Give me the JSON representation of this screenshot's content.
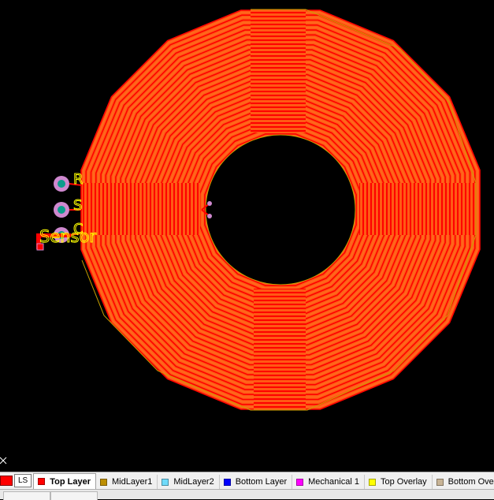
{
  "colors": {
    "board_bg": "#000000",
    "copper_top": "#ff0000",
    "copper_base": "#ff5a14",
    "silkscreen": "#ffff00",
    "outline": "#c8a000",
    "pad_ring": "#cf88cf",
    "pad_center": "#0c9c8c"
  },
  "silkscreen": {
    "label_r": "R",
    "label_s": "S",
    "label_c": "C",
    "designator": "Sensor"
  },
  "layer_bar": {
    "ls_label": "LS",
    "tabs": [
      {
        "name": "top-layer",
        "label": "Top Layer",
        "color": "#ff0000",
        "active": true
      },
      {
        "name": "midlayer1",
        "label": "MidLayer1",
        "color": "#bc8e00",
        "active": false
      },
      {
        "name": "midlayer2",
        "label": "MidLayer2",
        "color": "#70dbfa",
        "active": false
      },
      {
        "name": "bottom-layer",
        "label": "Bottom Layer",
        "color": "#0000ff",
        "active": false
      },
      {
        "name": "mechanical-1",
        "label": "Mechanical 1",
        "color": "#ff00ff",
        "active": false
      },
      {
        "name": "top-overlay",
        "label": "Top Overlay",
        "color": "#ffff00",
        "active": false
      },
      {
        "name": "bottom-overlay",
        "label": "Bottom Over",
        "color": "#c8b496",
        "active": false
      }
    ]
  }
}
